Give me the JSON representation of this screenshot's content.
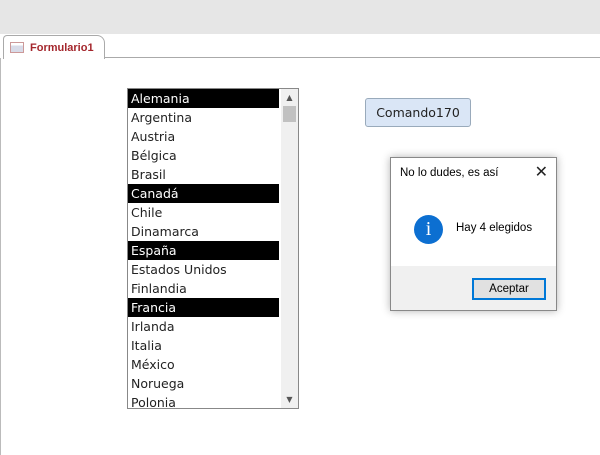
{
  "tab": {
    "label": "Formulario1",
    "icon": "form-icon"
  },
  "listbox": {
    "items": [
      {
        "label": "Alemania",
        "selected": true
      },
      {
        "label": "Argentina",
        "selected": false
      },
      {
        "label": "Austria",
        "selected": false
      },
      {
        "label": "Bélgica",
        "selected": false
      },
      {
        "label": "Brasil",
        "selected": false
      },
      {
        "label": "Canadá",
        "selected": true
      },
      {
        "label": "Chile",
        "selected": false
      },
      {
        "label": "Dinamarca",
        "selected": false
      },
      {
        "label": "España",
        "selected": true
      },
      {
        "label": "Estados Unidos",
        "selected": false
      },
      {
        "label": "Finlandia",
        "selected": false
      },
      {
        "label": "Francia",
        "selected": true
      },
      {
        "label": "Irlanda",
        "selected": false
      },
      {
        "label": "Italia",
        "selected": false
      },
      {
        "label": "México",
        "selected": false
      },
      {
        "label": "Noruega",
        "selected": false
      },
      {
        "label": "Polonia",
        "selected": false
      }
    ]
  },
  "command_button": {
    "label": "Comando170"
  },
  "dialog": {
    "title": "No lo dudes, es así",
    "message": "Hay 4 elegidos",
    "ok_label": "Aceptar",
    "icon": "info-icon"
  }
}
